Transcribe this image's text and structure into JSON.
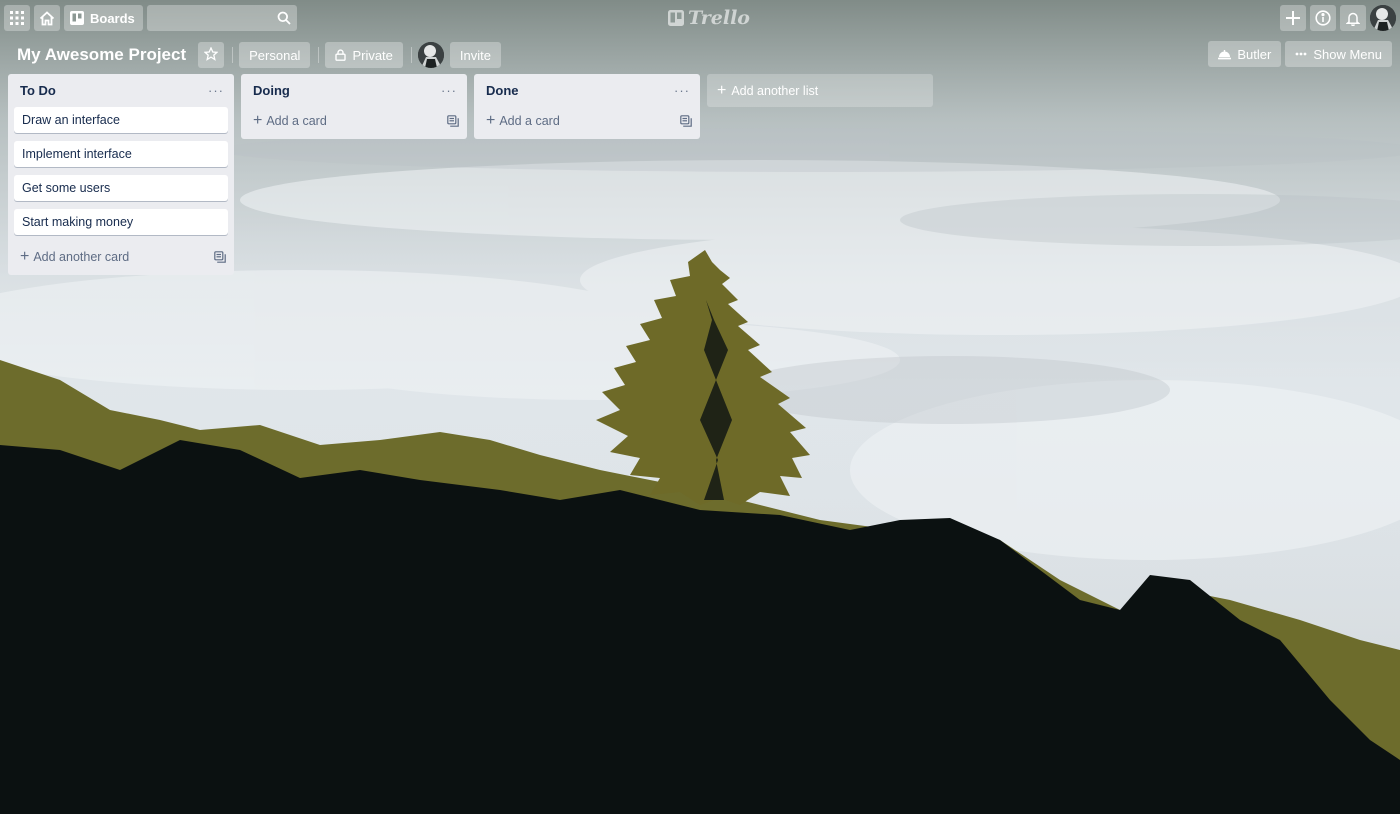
{
  "topbar": {
    "boards_label": "Boards",
    "search_placeholder": "",
    "logo_text": "Trello",
    "icons": [
      "apps-grid-icon",
      "home-icon",
      "boards-icon",
      "search-icon",
      "plus-icon",
      "info-icon",
      "bell-icon"
    ]
  },
  "board": {
    "title": "My Awesome Project",
    "team_label": "Personal",
    "visibility_label": "Private",
    "invite_label": "Invite",
    "butler_label": "Butler",
    "show_menu_label": "Show Menu"
  },
  "lists": [
    {
      "title": "To Do",
      "menu": "···",
      "cards": [
        "Draw an interface",
        "Implement interface",
        "Get some users",
        "Start making money"
      ],
      "add_label": "Add another card"
    },
    {
      "title": "Doing",
      "menu": "···",
      "cards": [],
      "add_label": "Add a card"
    },
    {
      "title": "Done",
      "menu": "···",
      "cards": [],
      "add_label": "Add a card"
    }
  ],
  "add_list_label": "Add another list",
  "colors": {
    "list_bg": "#ebecf0",
    "card_bg": "#ffffff",
    "text": "#172b4d",
    "muted_text": "#5e6c84",
    "header_button": "rgba(255,255,255,0.30)"
  }
}
